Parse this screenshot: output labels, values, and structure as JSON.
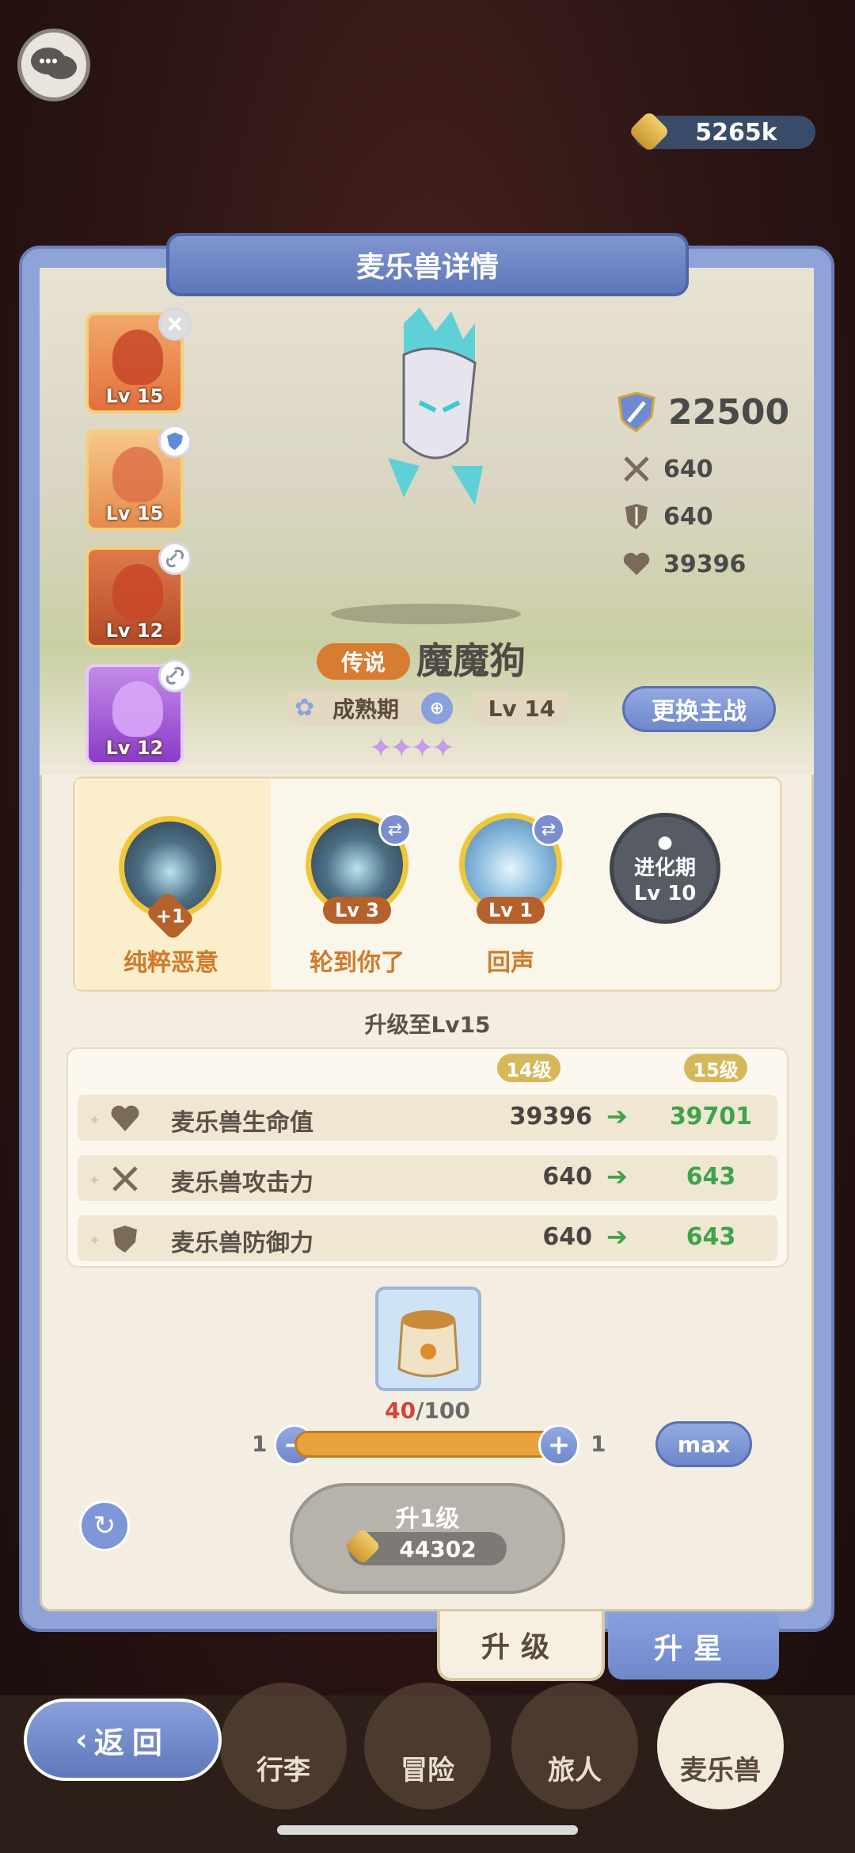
{
  "top": {
    "coins": "5265k"
  },
  "panel": {
    "title": "麦乐兽详情"
  },
  "roster": [
    {
      "level": "Lv 15",
      "badge": "close-icon"
    },
    {
      "level": "Lv 15",
      "badge": "shield-icon"
    },
    {
      "level": "Lv 12",
      "badge": "link-icon"
    },
    {
      "level": "Lv 12",
      "badge": "link-icon"
    }
  ],
  "stats": {
    "power": "22500",
    "attack": "640",
    "defense": "640",
    "hp": "39396"
  },
  "monster": {
    "rarity": "传说",
    "name": "魔魔狗",
    "stage": "成熟期",
    "level": "Lv 14",
    "stars": 4,
    "swap_label": "更换主战"
  },
  "skills": [
    {
      "name": "纯粹恶意",
      "badge": "+1"
    },
    {
      "name": "轮到你了",
      "level": "Lv 3"
    },
    {
      "name": "回声",
      "level": "Lv 1"
    }
  ],
  "locked_skill": {
    "line1": "进化期",
    "line2": "Lv 10"
  },
  "upgrade": {
    "title": "升级至Lv15",
    "from_label": "14级",
    "to_label": "15级",
    "rows": [
      {
        "label": "麦乐兽生命值",
        "from": "39396",
        "to": "39701",
        "icon": "heart-icon"
      },
      {
        "label": "麦乐兽攻击力",
        "from": "640",
        "to": "643",
        "icon": "swords-icon"
      },
      {
        "label": "麦乐兽防御力",
        "from": "640",
        "to": "643",
        "icon": "shield-icon"
      }
    ]
  },
  "item": {
    "have": "40",
    "need": "/100"
  },
  "slider": {
    "min": "1",
    "max": "1",
    "max_label": "max"
  },
  "action": {
    "label": "升1级",
    "cost": "44302"
  },
  "tabs": {
    "upgrade": "升级",
    "star": "升星"
  },
  "nav": {
    "items": [
      "行李",
      "冒险",
      "旅人",
      "麦乐兽"
    ],
    "back": "返回"
  },
  "colors": {
    "accent": "#6f88cc",
    "gold": "#f1c73a",
    "green": "#3fa34a",
    "legend": "#d67d32"
  }
}
